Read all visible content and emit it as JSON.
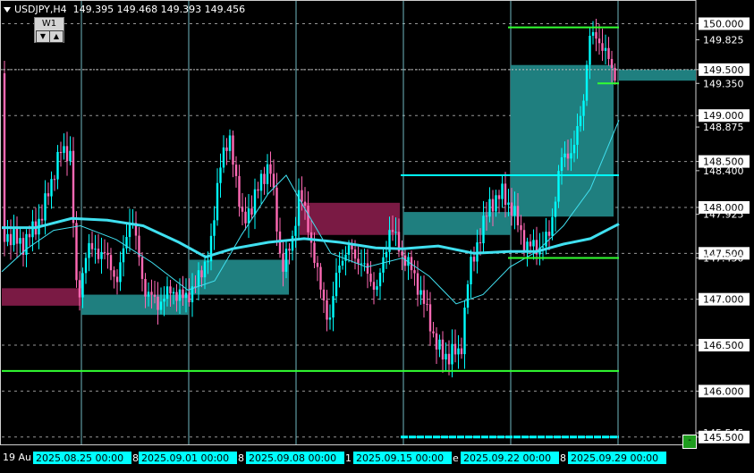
{
  "header": {
    "symbol": "USDJPY,H4",
    "ohlc": "149.395 149.468 149.393 149.456"
  },
  "timeframe": {
    "label": "W1",
    "down": "▼",
    "up": "▲"
  },
  "price_axis": {
    "labels": [
      "150.000",
      "149.825",
      "149.500",
      "149.350",
      "149.000",
      "148.875",
      "148.500",
      "148.400",
      "148.000",
      "147.925",
      "147.500",
      "147.450",
      "147.000",
      "146.500",
      "146.000",
      "145.545",
      "145.500"
    ],
    "highlighted": [
      "150.000",
      "149.500",
      "149.000",
      "148.500",
      "148.000",
      "147.500",
      "147.000",
      "146.500",
      "146.000",
      "145.500"
    ]
  },
  "time_axis": {
    "left_fragment": "19 Au",
    "labels": [
      "2025.08.25 00:00",
      "2025.09.01 00:00",
      "2025.09.08 00:00",
      "2025.09.15 00:00",
      "2025.09.22 00:00",
      "2025.09.29 00:00"
    ],
    "between": [
      "8",
      "8",
      "1",
      "e",
      "8"
    ]
  },
  "ui": {
    "corner_button": "-"
  },
  "colors": {
    "background": "#000000",
    "grid": "#c8c8c8",
    "bull": "#00ffff",
    "bear": "#ff69b4",
    "ma": "#40e0f0",
    "green_line": "#32ff32",
    "supply_zone": "#7a1a44",
    "demand_zone": "#1f7f7f",
    "period_line": "#8ee8f0",
    "axis_label_bg": "#00ffff"
  },
  "chart_data": {
    "type": "candlestick",
    "symbol": "USDJPY",
    "timeframe": "H4",
    "ylim": [
      145.42,
      150.18
    ],
    "candles": [],
    "ma_series_names": []
  }
}
